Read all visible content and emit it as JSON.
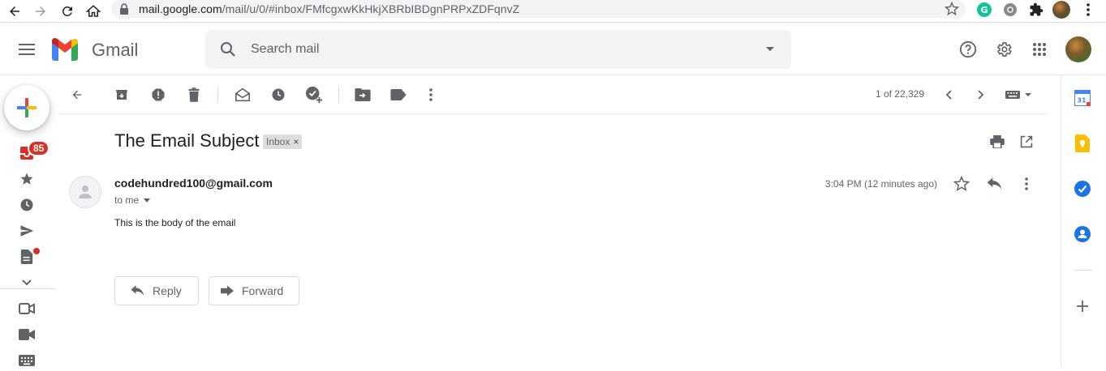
{
  "browser": {
    "url_host": "mail.google.com",
    "url_path": "/mail/u/0/#inbox/FMfcgxwKkHkjXBRbIBDgnPRPxZDFqnvZ"
  },
  "header": {
    "app_name": "Gmail",
    "search_placeholder": "Search mail"
  },
  "nav": {
    "inbox_badge": "85"
  },
  "toolbar": {
    "pager": "1 of 22,329"
  },
  "email": {
    "subject": "The Email Subject",
    "label": "Inbox",
    "sender": "codehundred100@gmail.com",
    "recipient": "to me",
    "time": "3:04 PM (12 minutes ago)",
    "body": "This is the body of the email"
  },
  "actions": {
    "reply_label": "Reply",
    "forward_label": "Forward"
  },
  "side_panel": {
    "calendar_day": "31"
  },
  "colors": {
    "accent_red": "#d93025",
    "icon_gray": "#5f6368",
    "search_bg": "#f1f3f4"
  }
}
